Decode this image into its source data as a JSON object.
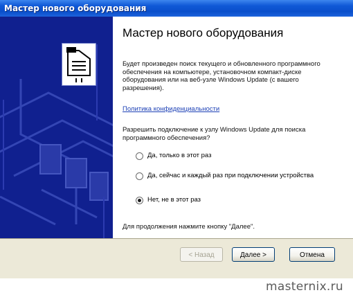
{
  "window": {
    "title": "Мастер нового оборудования"
  },
  "content": {
    "heading": "Мастер нового оборудования",
    "paragraph": "Будет произведен поиск текущего и обновленного программного обеспечения на компьютере, установочном компакт-диске оборудования или на веб-узле Windows Update (с вашего разрешения).",
    "privacy_link": "Политика конфиденциальности",
    "question": "Разрешить подключение к узлу Windows Update для поиска программного обеспечения?",
    "options": [
      {
        "label": "Да, только в этот раз",
        "checked": false
      },
      {
        "label": "Да, сейчас и каждый раз при подключении устройства",
        "checked": false
      },
      {
        "label": "Нет, не в этот раз",
        "checked": true
      }
    ],
    "instruction": "Для продолжения нажмите кнопку \"Далее\"."
  },
  "buttons": {
    "back": "< Назад",
    "next": "Далее >",
    "cancel": "Отмена"
  },
  "watermark": "masternix.ru",
  "colors": {
    "titlebar": "#0a4fcb",
    "sidebar": "#10208f",
    "footer": "#ece9d8"
  }
}
